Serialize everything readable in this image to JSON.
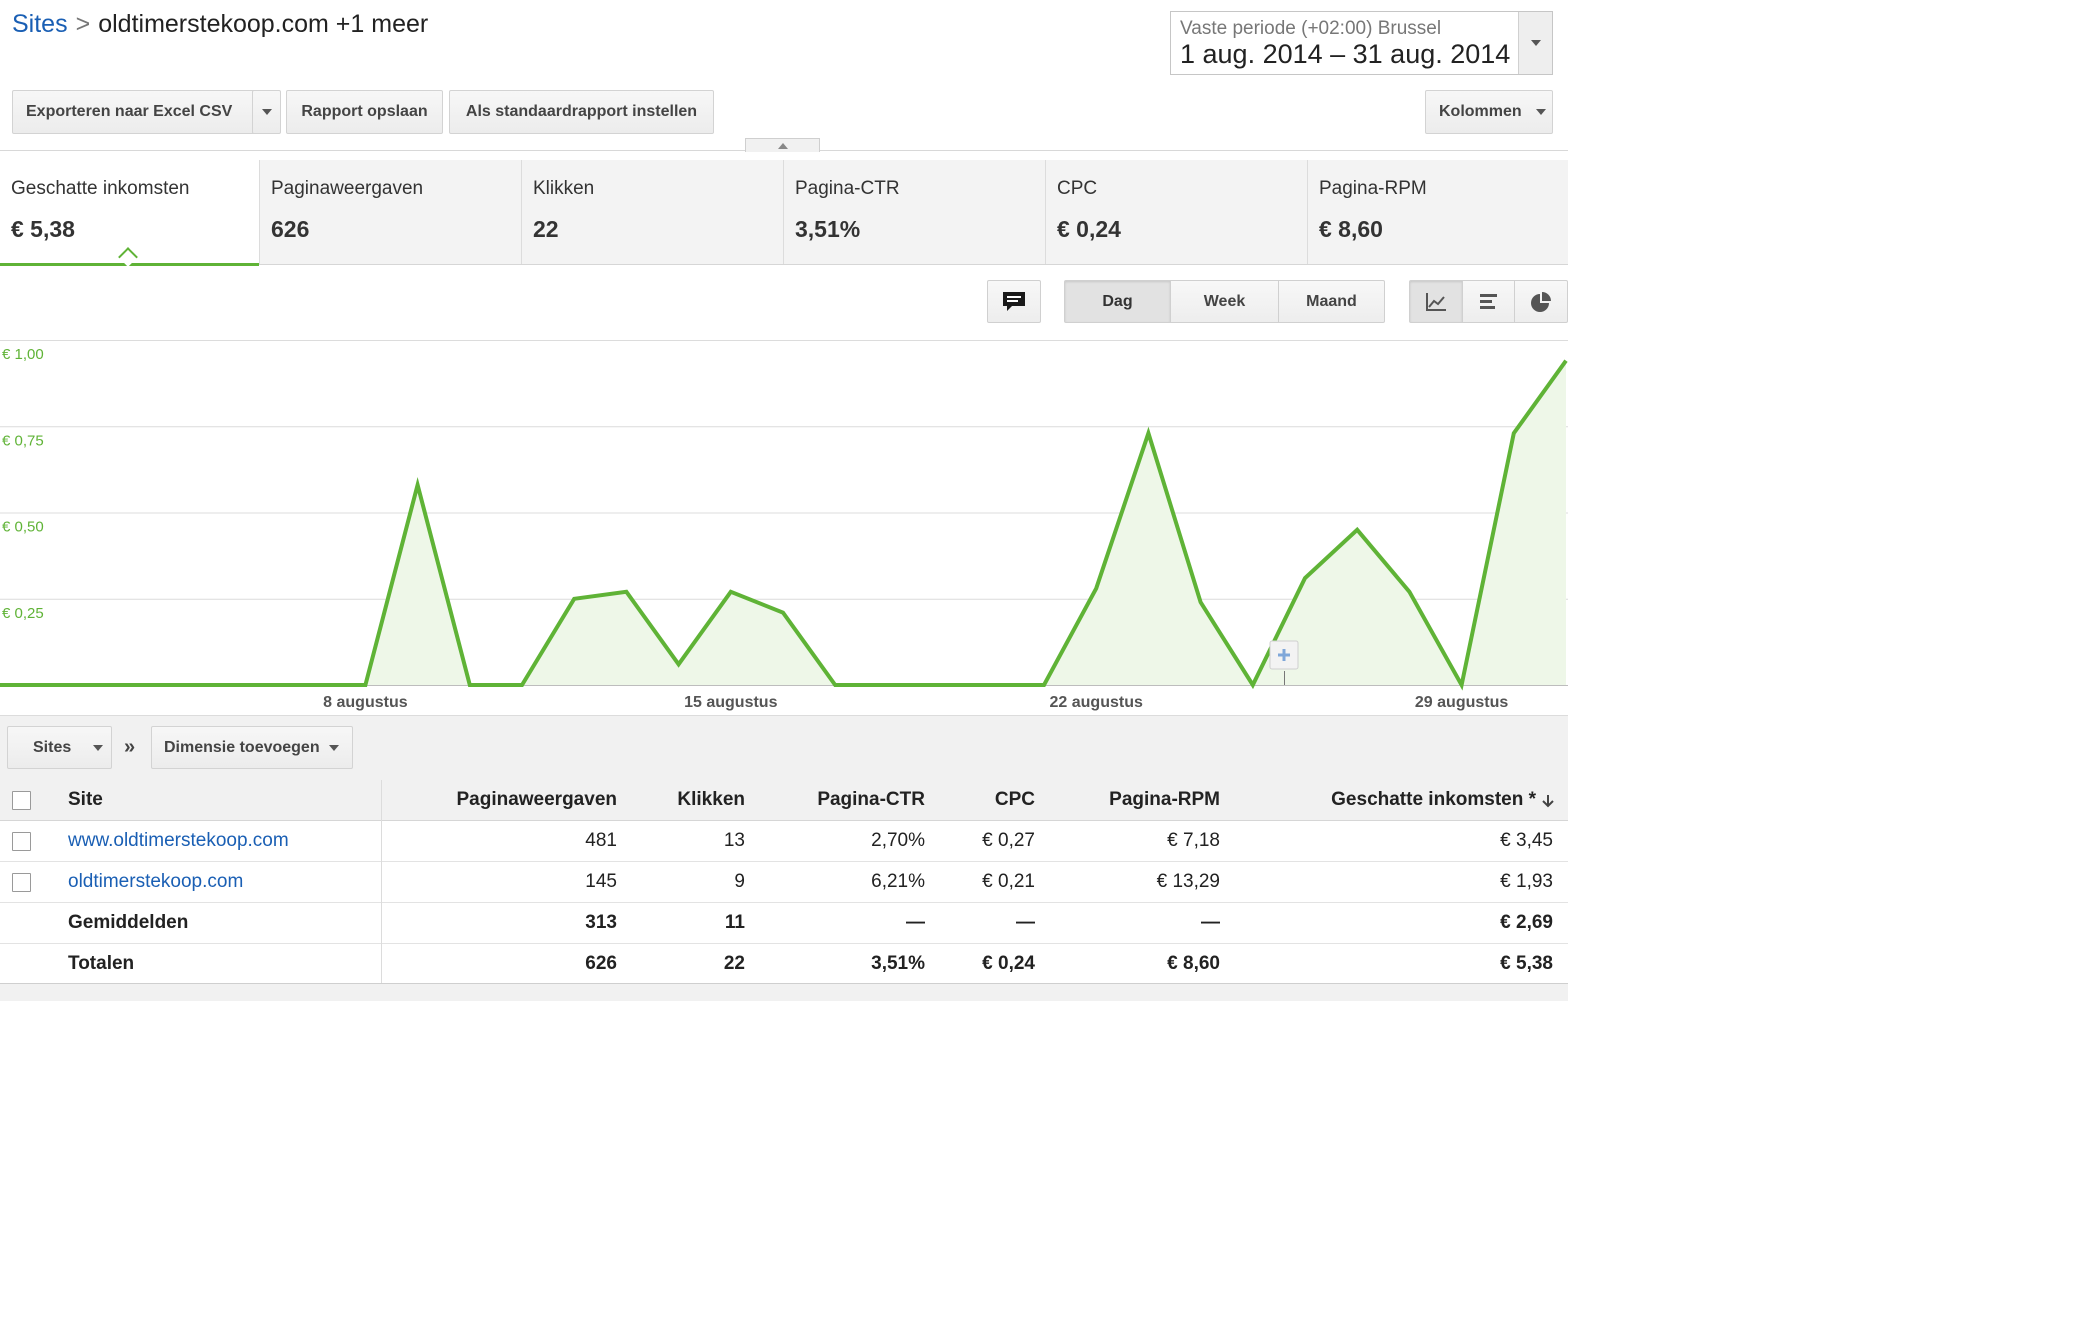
{
  "breadcrumb": {
    "root": "Sites",
    "separator": ">",
    "current": "oldtimerstekoop.com +1 meer"
  },
  "date_range": {
    "label": "Vaste periode (+02:00) Brussel",
    "value": "1 aug. 2014 – 31 aug. 2014"
  },
  "toolbar": {
    "export": "Exporteren naar Excel CSV",
    "save": "Rapport opslaan",
    "set_default": "Als standaardrapport instellen",
    "columns": "Kolommen"
  },
  "scorecards": [
    {
      "name": "Geschatte inkomsten",
      "value": "€ 5,38",
      "active": true
    },
    {
      "name": "Paginaweergaven",
      "value": "626"
    },
    {
      "name": "Klikken",
      "value": "22"
    },
    {
      "name": "Pagina-CTR",
      "value": "3,51%"
    },
    {
      "name": "CPC",
      "value": "€ 0,24"
    },
    {
      "name": "Pagina-RPM",
      "value": "€ 8,60"
    }
  ],
  "chart_controls": {
    "annotation_icon": "comment-icon",
    "granularity": [
      "Dag",
      "Week",
      "Maand"
    ],
    "selected_granularity": "Dag",
    "views": [
      "line-chart-icon",
      "bar-chart-icon",
      "pie-chart-icon"
    ],
    "selected_view": "line-chart-icon"
  },
  "chart_data": {
    "type": "area",
    "series": [
      {
        "values": [
          0,
          0,
          0,
          0,
          0,
          0,
          0,
          0,
          0.58,
          0,
          0,
          0.25,
          0.27,
          0.06,
          0.27,
          0.21,
          0,
          0,
          0,
          0,
          0,
          0.28,
          0.73,
          0.24,
          0,
          0.31,
          0.45,
          0.27,
          0,
          0.73,
          0.94
        ]
      }
    ],
    "x": [
      1,
      2,
      3,
      4,
      5,
      6,
      7,
      8,
      9,
      10,
      11,
      12,
      13,
      14,
      15,
      16,
      17,
      18,
      19,
      20,
      21,
      22,
      23,
      24,
      25,
      26,
      27,
      28,
      29,
      30,
      31
    ],
    "x_tick_labels": [
      "8 augustus",
      "15 augustus",
      "22 augustus",
      "29 augustus"
    ],
    "y_tick_labels": [
      "€ 1,00",
      "€ 0,75",
      "€ 0,50",
      "€ 0,25"
    ],
    "ylim": [
      0,
      1.0
    ],
    "grid": true,
    "color": "#5fb336",
    "fill": "#eef7e8"
  },
  "dimension_bar": {
    "primary": "Sites",
    "separator": "»",
    "add": "Dimensie toevoegen"
  },
  "table": {
    "columns": [
      "Site",
      "Paginaweergaven",
      "Klikken",
      "Pagina-CTR",
      "CPC",
      "Pagina-RPM",
      "Geschatte inkomsten *"
    ],
    "sort_icon": "arrow-down-icon",
    "rows": [
      {
        "site": "www.oldtimerstekoop.com",
        "views": "481",
        "clicks": "13",
        "ctr": "2,70%",
        "cpc": "€ 0,27",
        "rpm": "€ 7,18",
        "revenue": "€ 3,45"
      },
      {
        "site": "oldtimerstekoop.com",
        "views": "145",
        "clicks": "9",
        "ctr": "6,21%",
        "cpc": "€ 0,21",
        "rpm": "€ 13,29",
        "revenue": "€ 1,93"
      }
    ],
    "averages": {
      "label": "Gemiddelden",
      "views": "313",
      "clicks": "11",
      "ctr": "—",
      "cpc": "—",
      "rpm": "—",
      "revenue": "€ 2,69"
    },
    "totals": {
      "label": "Totalen",
      "views": "626",
      "clicks": "22",
      "ctr": "3,51%",
      "cpc": "€ 0,24",
      "rpm": "€ 8,60",
      "revenue": "€ 5,38"
    }
  }
}
